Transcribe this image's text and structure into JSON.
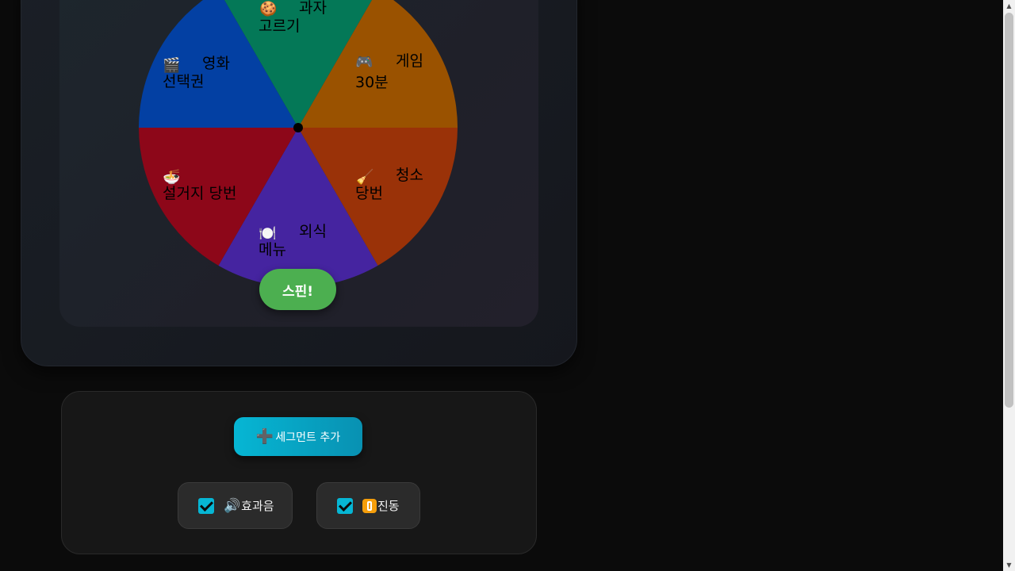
{
  "wheel": {
    "segments": [
      {
        "icon": "🍪",
        "line1": "과자",
        "line2": "고르기",
        "color": "#047857"
      },
      {
        "icon": "🎮",
        "line1": "게임",
        "line2": "30분",
        "color": "#9a5200"
      },
      {
        "icon": "🧹",
        "line1": "청소",
        "line2": "당번",
        "color": "#9a3208"
      },
      {
        "icon": "🍽️",
        "line1": "외식",
        "line2": "메뉴",
        "color": "#4524a0"
      },
      {
        "icon": "🍜",
        "line1": "설거지 당번",
        "line2": "",
        "color": "#8d0719"
      },
      {
        "icon": "🎬",
        "line1": "영화",
        "line2": "선택권",
        "color": "#0340a3"
      }
    ],
    "spin_label": "스핀!",
    "spin_color": "#4caf50"
  },
  "controls": {
    "add_segment_icon": "➕",
    "add_segment_label": "세그먼트 추가",
    "sound": {
      "icon": "🔊",
      "label": "효과음",
      "checked": true
    },
    "vibration": {
      "icon": "📳",
      "label": "진동",
      "checked": true
    }
  },
  "scrollbar": {
    "up_icon": "▲",
    "down_icon": "▼"
  }
}
